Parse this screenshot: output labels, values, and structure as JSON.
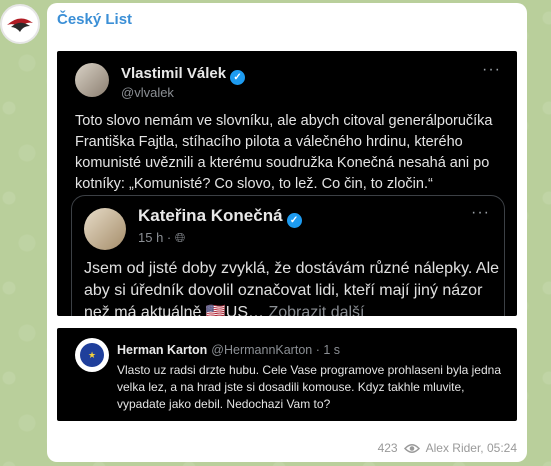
{
  "channel": {
    "name": "Český List"
  },
  "post1": {
    "author": "Vlastimil Válek",
    "handle": "@vlvalek",
    "text": "Toto slovo nemám ve slovníku, ale abych citoval generálporučíka Františka Fajtla, stíhacího pilota a válečného hrdinu, kterého komunisté uvěznili a kterému soudružka Konečná nesahá ani po kotníky: „Komunisté? Co slovo, to lež. Co čin, to zločin.“"
  },
  "quote": {
    "author": "Kateřina Konečná",
    "meta": "15 h ·",
    "text": "Jsem od jisté doby zvyklá, že dostávám různé nálepky. Ale aby si úředník dovolil označovat lidi, kteří mají jiný názor než má aktuálně 🇺🇸US…",
    "more": " Zobrazit další"
  },
  "post2": {
    "author": "Herman Karton",
    "handle": "@HermannKarton · 1 s",
    "text": "Vlasto uz radsi drzte hubu. Cele Vase programove prohlaseni byla jedna velka lez, a na hrad jste si dosadili komouse. Kdyz takhle mluvite, vypadate jako debil. Nedochazi Vam to?"
  },
  "footer": {
    "views": "423",
    "author_time": "Alex Rider, 05:24"
  },
  "icons": {
    "verified": "verified-check-icon",
    "globe": "globe-icon",
    "eye": "eye-icon",
    "more": "more-dots-icon"
  }
}
